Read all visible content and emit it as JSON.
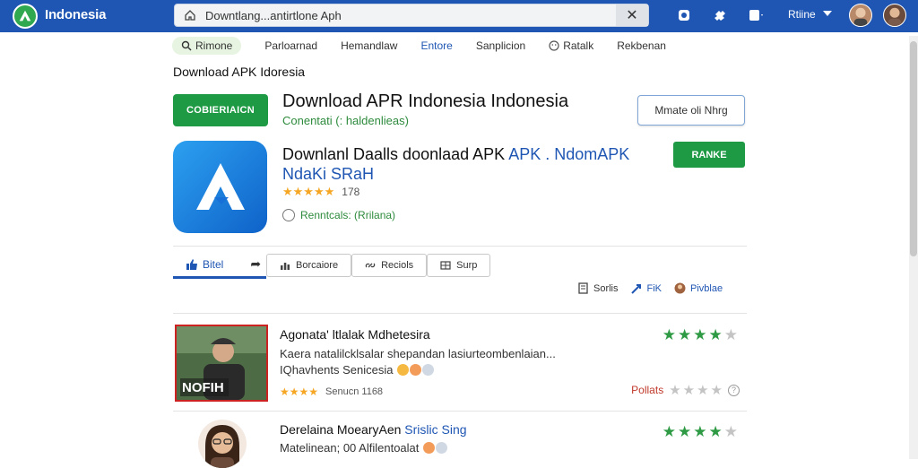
{
  "topbar": {
    "brand": "Indonesia",
    "url": "Downtlang...antirtlone Aph",
    "clear_symbol": "✕",
    "user_label": "Rtiine",
    "icons": [
      "home-icon",
      "notification-icon",
      "puzzle-icon",
      "apps-icon"
    ]
  },
  "nav": {
    "items": [
      {
        "label": "Rimone",
        "icon": "search-icon",
        "active": true
      },
      {
        "label": "Parloarnad"
      },
      {
        "label": "Hemandlaw"
      },
      {
        "label": "Entore",
        "highlight": true
      },
      {
        "label": "Sanplicion"
      },
      {
        "label": "Ratalk",
        "icon": "smiley-icon"
      },
      {
        "label": "Rekbenan"
      }
    ]
  },
  "page": {
    "heading": "Download APK Idoresia"
  },
  "hero": {
    "download_label": "COBIERIAICN",
    "title": "Download APR Indonesia Indonesia",
    "subtitle": "Conentati (: haldenlieas)",
    "outline_button": "Mmate oli Nhrg",
    "title2_main": "Downlanl Daalls doonlaad APK",
    "title2_blue": "APK . NdomAPK",
    "title2_line2": "NdaKi SRaH",
    "stars": "★★★★★",
    "rating_count": "178",
    "status": "Renntcals: (Rrilana)",
    "green_button": "RANKE"
  },
  "tabs": {
    "active_label": "Bitel",
    "items": [
      "Borcaiore",
      "Reciols",
      "Surp"
    ]
  },
  "meta": {
    "items": [
      {
        "label": "Sorlis",
        "icon": "document-icon"
      },
      {
        "label": "FiK",
        "icon": "share-icon"
      },
      {
        "label": "Pivblae",
        "icon": "avatar-icon"
      }
    ]
  },
  "reviews": [
    {
      "title": "Agonata' ltlalak Mdhetesira",
      "body1": "Kaera natalilcklsalar shepandan lasiurteombenlaian...",
      "body2": "IQhavhents Senicesia",
      "stars": "★★★★",
      "meta": "Senucn 1168",
      "thumb_text": "NOFIH",
      "rating_label": "Pollats",
      "green_stars": 4
    },
    {
      "title_main": "Derelaina MoearyAen",
      "title_blue": "Srislic Sing",
      "body1": "Matelinean; 00 Alfilentoalat",
      "green_stars": 4
    }
  ],
  "colors": {
    "topbar": "#1f56b3",
    "green": "#1e9a44",
    "accent_blue": "#1f56b3",
    "star_gold": "#f5a623"
  }
}
